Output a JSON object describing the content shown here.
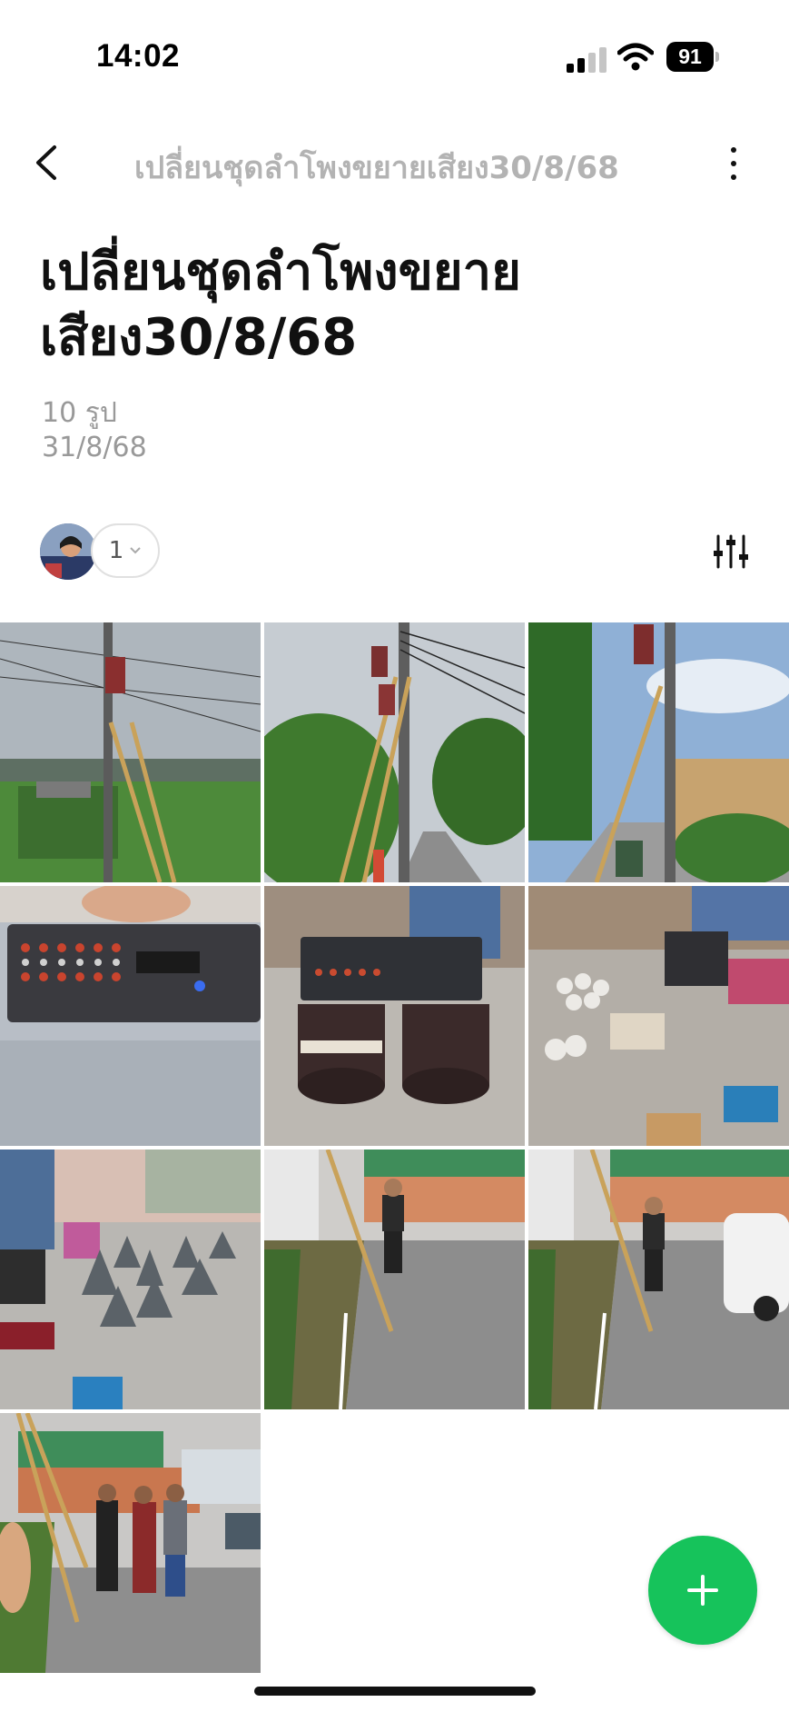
{
  "status_bar": {
    "time": "14:02",
    "battery": "91"
  },
  "nav": {
    "title": "เปลี่ยนชุดลำโพงขยายเสียง30/8/68"
  },
  "album": {
    "title": "เปลี่ยนชุดลำโพงขยายเสียง30/8/68",
    "photo_count": "10 รูป",
    "date": "31/8/68"
  },
  "members": {
    "count": "1"
  },
  "photos": [
    {
      "desc": "worker on pole with ladder, fields"
    },
    {
      "desc": "workers on pole by road"
    },
    {
      "desc": "worker on pole near fence"
    },
    {
      "desc": "amplifier mixer close-up"
    },
    {
      "desc": "amplifier on cable reels"
    },
    {
      "desc": "speakers and amplifier on floor"
    },
    {
      "desc": "person assembling horn speakers"
    },
    {
      "desc": "man holding speaker by ladder"
    },
    {
      "desc": "man holding speaker near truck"
    },
    {
      "desc": "group photo in front of temple"
    }
  ],
  "colors": {
    "accent": "#16c35b",
    "muted": "#999999"
  }
}
